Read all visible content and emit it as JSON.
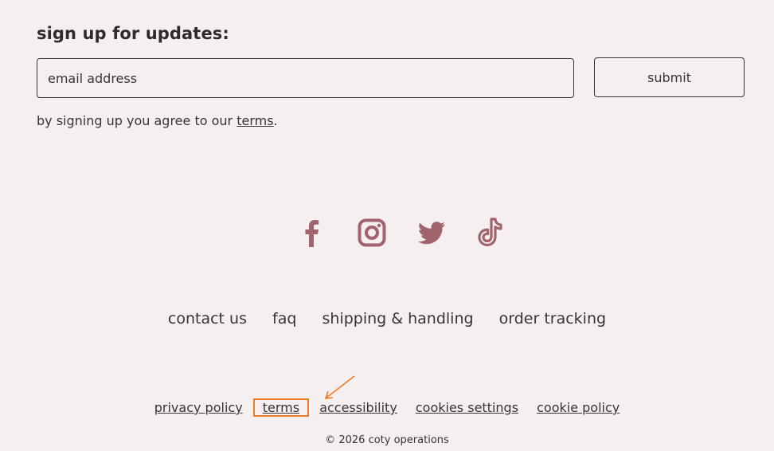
{
  "signup": {
    "title": "sign up for updates:",
    "email_placeholder": "email address",
    "email_value": "",
    "submit_label": "submit",
    "agree_prefix": "by signing up you agree to our",
    "agree_link": "terms",
    "agree_suffix": "."
  },
  "social": {
    "color": "#a0646c",
    "icons": [
      "facebook-icon",
      "instagram-icon",
      "twitter-icon",
      "tiktok-icon"
    ]
  },
  "main_links": [
    "contact us",
    "faq",
    "shipping & handling",
    "order tracking"
  ],
  "legal_links": [
    "privacy policy",
    "terms",
    "accessibility",
    "cookies settings",
    "cookie policy"
  ],
  "highlight": {
    "color": "#ee7b25"
  },
  "copyright": "© 2026 coty operations"
}
